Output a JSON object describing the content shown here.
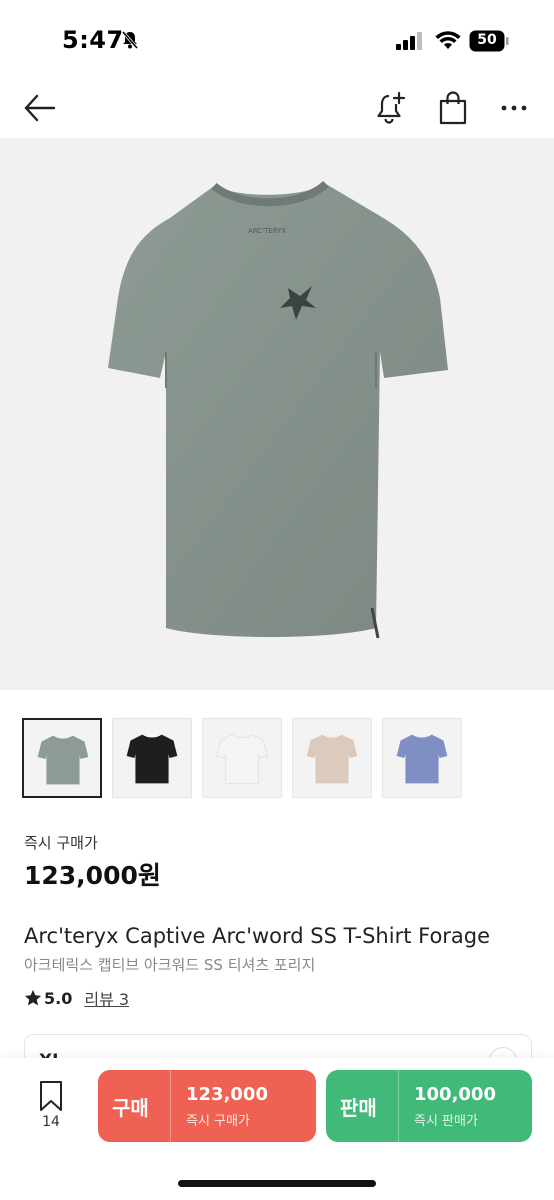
{
  "status_bar": {
    "time": "5:47",
    "battery": "50"
  },
  "nav": {
    "icons": [
      "back-arrow-icon",
      "bell-plus-icon",
      "shopping-bag-icon",
      "more-icon"
    ]
  },
  "product": {
    "thumbnail_colors": [
      "#8e9b94",
      "#1e1e1e",
      "#f4f4f4",
      "#dccbbd",
      "#7f8fc4"
    ],
    "price_label": "즉시 구매가",
    "price": "123,000원",
    "title_en": "Arc'teryx Captive Arc'word SS T-Shirt Forage",
    "title_ko": "아크테릭스 캡티브 아크워드 SS 티셔츠 포리지",
    "rating": "5.0",
    "review_text": "리뷰 3",
    "option_label": "XL"
  },
  "bottom_bar": {
    "bookmark_count": "14",
    "buy": {
      "label": "구매",
      "price": "123,000",
      "sub": "즉시 구매가",
      "color": "#ef6253"
    },
    "sell": {
      "label": "판매",
      "price": "100,000",
      "sub": "즉시 판매가",
      "color": "#41b979"
    }
  }
}
